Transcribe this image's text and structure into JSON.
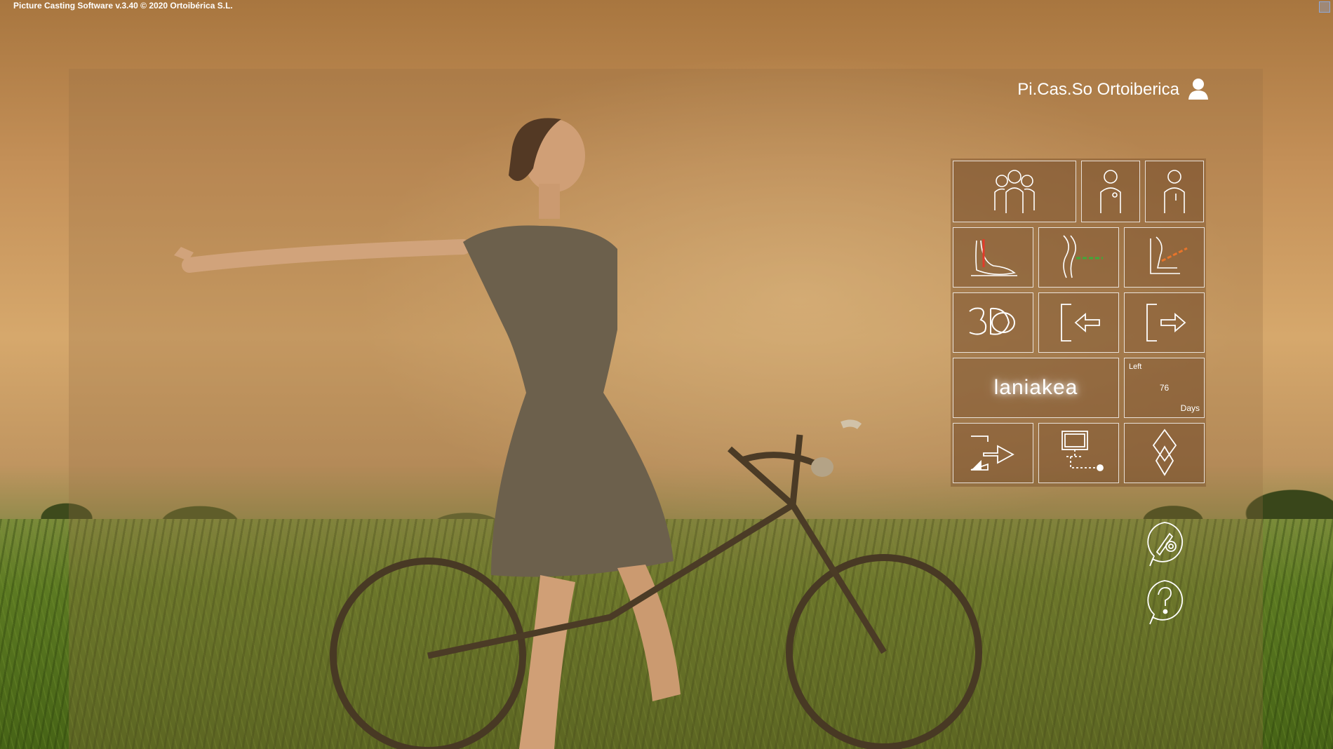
{
  "window": {
    "title": "Picture Casting Software  v.3.40  © 2020 Ortoibérica S.L."
  },
  "user": {
    "name": "Pi.Cas.So Ortoiberica",
    "icon": "user-icon"
  },
  "menu": {
    "tiles": [
      {
        "id": "patients",
        "icon": "group-users-icon"
      },
      {
        "id": "patient-female",
        "icon": "person-badge-icon"
      },
      {
        "id": "patient",
        "icon": "person-icon"
      },
      {
        "id": "foot-scan",
        "icon": "foot-red-line-icon"
      },
      {
        "id": "leg-scan",
        "icon": "leg-green-line-icon"
      },
      {
        "id": "seat-scan",
        "icon": "seat-orange-line-icon"
      },
      {
        "id": "view-3d",
        "icon": "3d-icon"
      },
      {
        "id": "import",
        "icon": "import-arrow-icon"
      },
      {
        "id": "export",
        "icon": "export-arrow-icon"
      },
      {
        "id": "laniakea",
        "label": "laniakea"
      },
      {
        "id": "license-days",
        "left_label": "Left",
        "value": "76",
        "unit_label": "Days"
      },
      {
        "id": "exit",
        "icon": "exit-document-icon"
      },
      {
        "id": "network",
        "icon": "monitor-network-icon"
      },
      {
        "id": "diamond",
        "icon": "diamond-icon"
      }
    ]
  },
  "side_buttons": [
    {
      "id": "settings",
      "icon": "tools-gear-chat-icon"
    },
    {
      "id": "help",
      "icon": "question-chat-icon"
    }
  ],
  "colors": {
    "panel": "#96704a",
    "tile_border": "#ffffff",
    "foot_line": "#e23b2a",
    "leg_line": "#3faa3a",
    "seat_line": "#e8742a"
  }
}
